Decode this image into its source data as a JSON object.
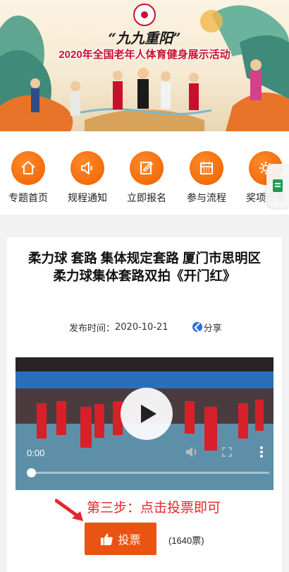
{
  "banner": {
    "subtitle": "“九九重阳”",
    "title": "2020年全国老年人体育健身展示活动",
    "logo_icon": "emblem-icon"
  },
  "nav": {
    "items": [
      {
        "label": "专题首页",
        "icon": "home-icon"
      },
      {
        "label": "规程通知",
        "icon": "speaker-icon"
      },
      {
        "label": "立即报名",
        "icon": "edit-icon"
      },
      {
        "label": "参与流程",
        "icon": "calendar-icon"
      },
      {
        "label": "奖项设置",
        "icon": "gear-icon"
      }
    ],
    "accent": "#f26c0c"
  },
  "article": {
    "title_line1": "柔力球 套路 集体规定套路 厦门市思明区",
    "title_line2": "柔力球集体套路双拍《开门红》",
    "published_label": "发布时间：",
    "published_date": "2020-10-21",
    "share_label": "分享"
  },
  "video": {
    "current_time": "0:00",
    "progress": 0
  },
  "vote": {
    "hint": "第三步：点击投票即可",
    "button_label": "投票",
    "count": "(1640票)",
    "button_color": "#ea5412",
    "hint_color": "#e8262a"
  }
}
